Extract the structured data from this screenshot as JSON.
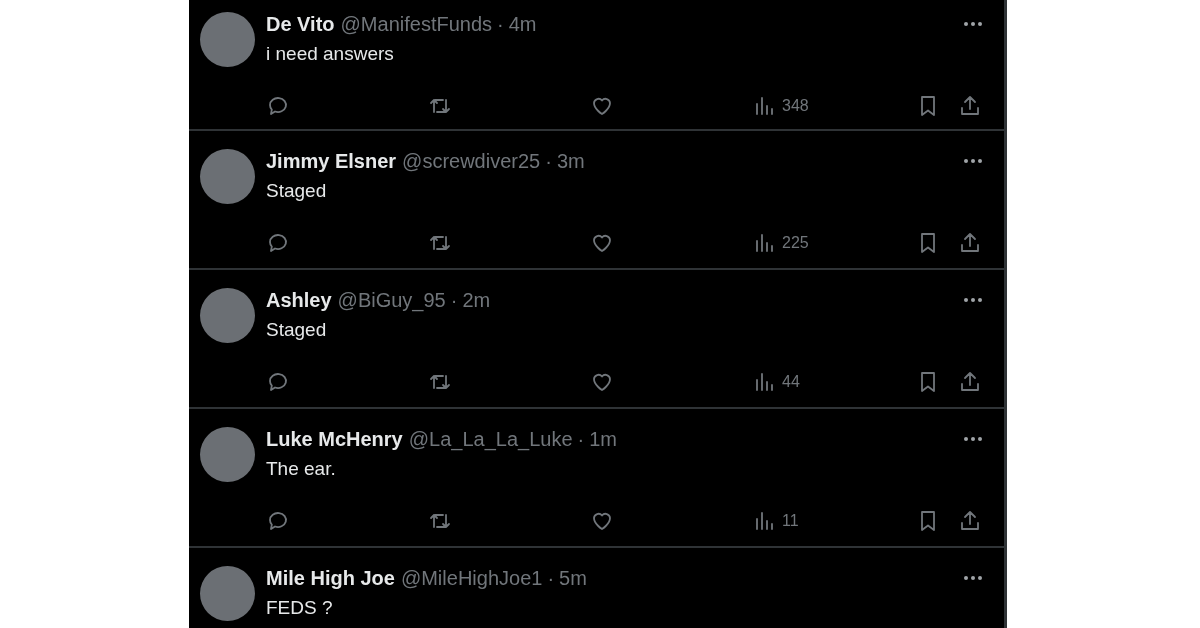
{
  "posts": [
    {
      "name": "De Vito",
      "handle": "@ManifestFunds",
      "separator": "·",
      "time": "4m",
      "text": "i need answers",
      "views": "348"
    },
    {
      "name": "Jimmy Elsner",
      "handle": "@screwdiver25",
      "separator": "·",
      "time": "3m",
      "text": "Staged",
      "views": "225"
    },
    {
      "name": "Ashley",
      "handle": "@BiGuy_95",
      "separator": "·",
      "time": "2m",
      "text": "Staged",
      "views": "44"
    },
    {
      "name": "Luke McHenry",
      "handle": "@La_La_La_Luke",
      "separator": "·",
      "time": "1m",
      "text": "The ear.",
      "views": "11"
    },
    {
      "name": "Mile High Joe",
      "handle": "@MileHighJoe1",
      "separator": "·",
      "time": "5m",
      "text": "FEDS ?"
    }
  ]
}
